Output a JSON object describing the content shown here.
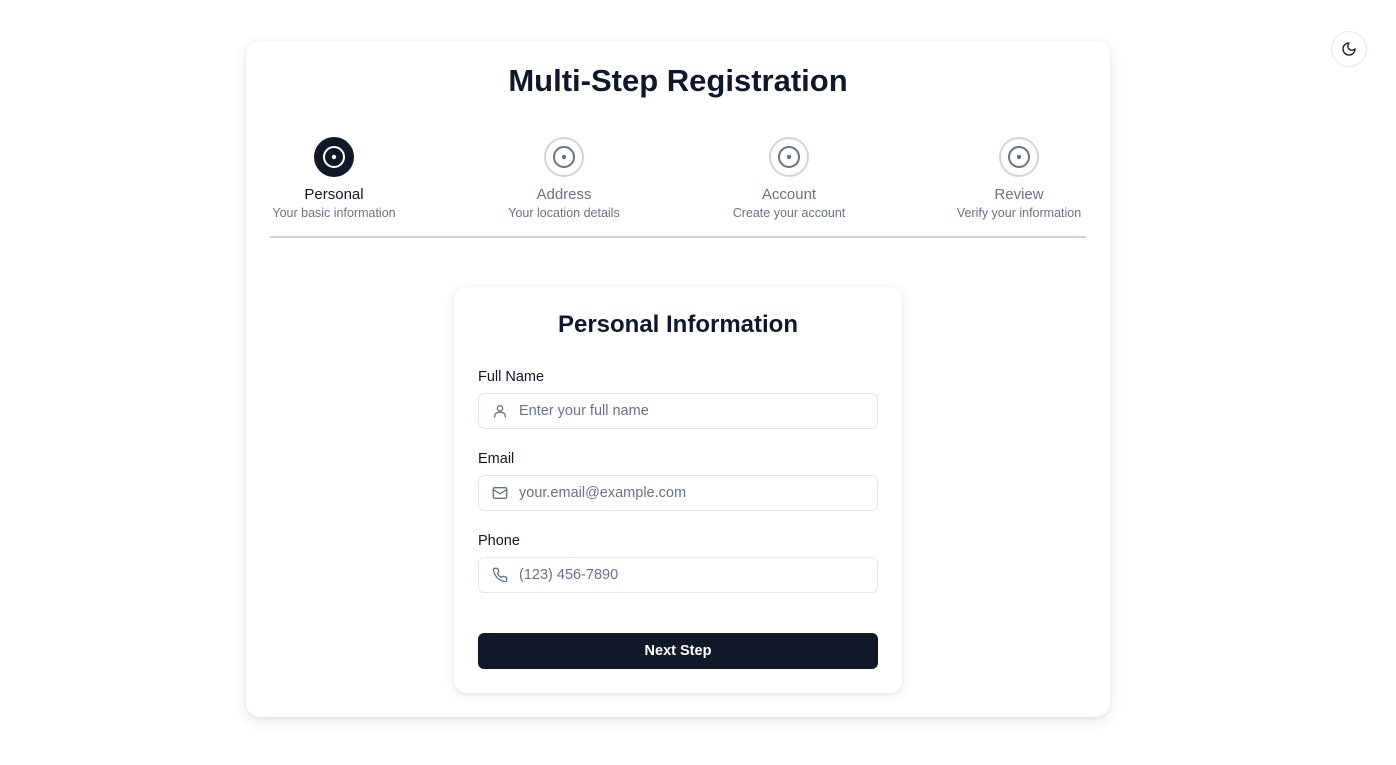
{
  "header": {
    "title": "Multi-Step Registration",
    "theme_toggle_icon": "moon-icon"
  },
  "steps": [
    {
      "label": "Personal",
      "description": "Your basic information",
      "active": true,
      "icon": "circle-dot-icon"
    },
    {
      "label": "Address",
      "description": "Your location details",
      "active": false,
      "icon": "circle-dot-icon"
    },
    {
      "label": "Account",
      "description": "Create your account",
      "active": false,
      "icon": "circle-dot-icon"
    },
    {
      "label": "Review",
      "description": "Verify your information",
      "active": false,
      "icon": "circle-dot-icon"
    }
  ],
  "form": {
    "title": "Personal Information",
    "fields": [
      {
        "label": "Full Name",
        "placeholder": "Enter your full name",
        "value": "",
        "icon": "user-icon"
      },
      {
        "label": "Email",
        "placeholder": "your.email@example.com",
        "value": "",
        "icon": "mail-icon"
      },
      {
        "label": "Phone",
        "placeholder": "(123) 456-7890",
        "value": "",
        "icon": "phone-icon"
      }
    ],
    "submit_label": "Next Step"
  },
  "colors": {
    "primary": "#111827",
    "muted_text": "#64748b",
    "border": "#e2e8f0"
  }
}
